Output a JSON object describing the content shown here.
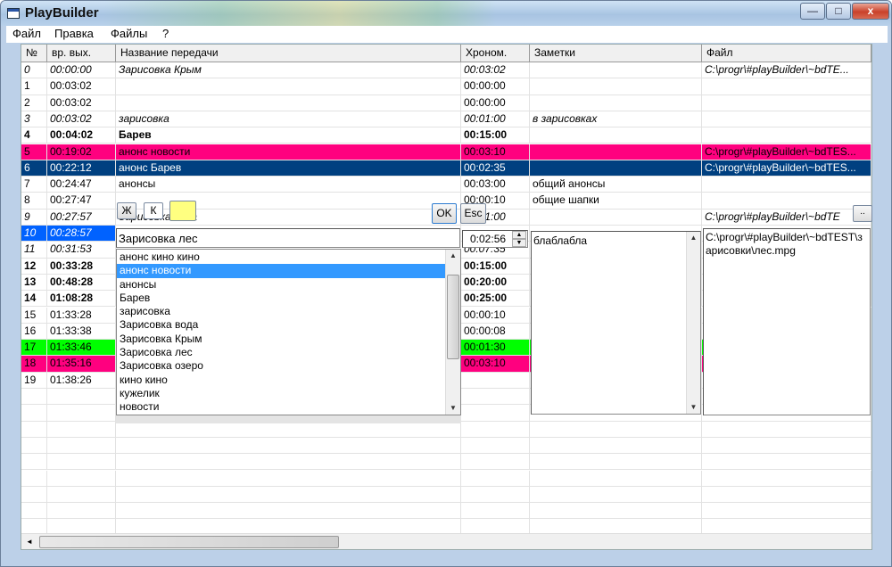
{
  "window": {
    "title": "PlayBuilder",
    "min": "—",
    "max": "□",
    "close": "x"
  },
  "menu": [
    "Файл",
    "Правка",
    "Файлы",
    "?"
  ],
  "columns": [
    "№",
    "вр. вых.",
    "Название передачи",
    "Хроном.",
    "Заметки",
    "Файл"
  ],
  "rows": [
    {
      "n": "0",
      "time": "00:00:00",
      "name": "Зарисовка Крым",
      "dur": "00:03:02",
      "note": "",
      "file": "C:\\progr\\#playBuilder\\~bdTE...",
      "style": "it"
    },
    {
      "n": "1",
      "time": "00:03:02",
      "name": "",
      "dur": "00:00:00",
      "note": "",
      "file": "",
      "style": ""
    },
    {
      "n": "2",
      "time": "00:03:02",
      "name": "",
      "dur": "00:00:00",
      "note": "",
      "file": "",
      "style": ""
    },
    {
      "n": "3",
      "time": "00:03:02",
      "name": "зарисовка",
      "dur": "00:01:00",
      "note": "в зарисовках",
      "file": "",
      "style": "it"
    },
    {
      "n": "4",
      "time": "00:04:02",
      "name": "Барев",
      "dur": "00:15:00",
      "note": "",
      "file": "",
      "style": "b"
    },
    {
      "n": "5",
      "time": "00:19:02",
      "name": "анонс новости",
      "dur": "00:03:10",
      "note": "",
      "file": "C:\\progr\\#playBuilder\\~bdTES...",
      "style": "pink"
    },
    {
      "n": "6",
      "time": "00:22:12",
      "name": "анонс Барев",
      "dur": "00:02:35",
      "note": "",
      "file": "C:\\progr\\#playBuilder\\~bdTES...",
      "style": "navy"
    },
    {
      "n": "7",
      "time": "00:24:47",
      "name": "анонсы",
      "dur": "00:03:00",
      "note": "общий анонсы",
      "file": "",
      "style": ""
    },
    {
      "n": "8",
      "time": "00:27:47",
      "name": "",
      "dur": "00:00:10",
      "note": "общие шапки",
      "file": "",
      "style": ""
    },
    {
      "n": "9",
      "time": "00:27:57",
      "name": "Зарисовка вода",
      "dur": "00:01:00",
      "note": "",
      "file": "C:\\progr\\#playBuilder\\~bdTE",
      "style": "it"
    },
    {
      "n": "10",
      "time": "00:28:57",
      "name": "",
      "dur": "",
      "note": "",
      "file": "",
      "style": "sel"
    },
    {
      "n": "11",
      "time": "00:31:53",
      "name": "",
      "dur": "00:07:35",
      "note": "",
      "file": "",
      "style": "it"
    },
    {
      "n": "12",
      "time": "00:33:28",
      "name": "",
      "dur": "00:15:00",
      "note": "",
      "file": "",
      "style": "b"
    },
    {
      "n": "13",
      "time": "00:48:28",
      "name": "",
      "dur": "00:20:00",
      "note": "",
      "file": "",
      "style": "b"
    },
    {
      "n": "14",
      "time": "01:08:28",
      "name": "",
      "dur": "00:25:00",
      "note": "",
      "file": "",
      "style": "b"
    },
    {
      "n": "15",
      "time": "01:33:28",
      "name": "",
      "dur": "00:00:10",
      "note": "",
      "file": "",
      "style": ""
    },
    {
      "n": "16",
      "time": "01:33:38",
      "name": "",
      "dur": "00:00:08",
      "note": "",
      "file": "",
      "style": ""
    },
    {
      "n": "17",
      "time": "01:33:46",
      "name": "",
      "dur": "00:01:30",
      "note": "",
      "file": "",
      "style": "green"
    },
    {
      "n": "18",
      "time": "01:35:16",
      "name": "",
      "dur": "00:03:10",
      "note": "",
      "file": "",
      "style": "pink"
    },
    {
      "n": "19",
      "time": "01:38:26",
      "name": "",
      "dur": "",
      "note": "",
      "file": "",
      "style": ""
    }
  ],
  "editor": {
    "format_bold": "Ж",
    "format_italic": "К",
    "ok": "OK",
    "esc": "Esc",
    "name_value": "Зарисовка лес",
    "dur_value": "0:02:56",
    "note_value": "блаблабла",
    "file_value": "C:\\progr\\#playBuilder\\~bdTEST\\зарисовки\\лес.mpg",
    "browse": "..",
    "color_swatch": "#ffff80"
  },
  "dropdown": {
    "items": [
      "анонс кино кино",
      "анонс новости",
      "анонсы",
      "Барев",
      "зарисовка",
      "Зарисовка вода",
      "Зарисовка Крым",
      "Зарисовка лес",
      "Зарисовка озеро",
      "кино кино",
      "кужелик",
      "новости"
    ],
    "selected_index": 1
  }
}
